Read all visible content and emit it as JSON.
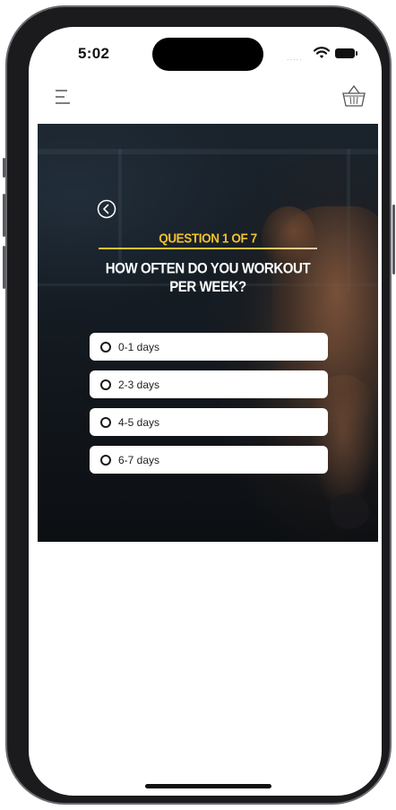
{
  "status_bar": {
    "time": "5:02",
    "signal": "....."
  },
  "quiz": {
    "counter": "QUESTION 1 OF 7",
    "question": "HOW OFTEN DO YOU WORKOUT PER WEEK?",
    "options": [
      {
        "label": "0-1 days",
        "selected": false
      },
      {
        "label": "2-3 days",
        "selected": false
      },
      {
        "label": "4-5 days",
        "selected": false
      },
      {
        "label": "6-7 days",
        "selected": false
      }
    ]
  },
  "icons": {
    "menu": "hamburger-menu-icon",
    "cart": "shopping-basket-icon",
    "back": "chevron-left-circle-icon",
    "wifi": "wifi-icon",
    "battery": "battery-icon"
  },
  "colors": {
    "accent": "#f2c12e",
    "hero_bg": "#141b22",
    "option_bg": "#ffffff",
    "question_text": "#ffffff"
  }
}
